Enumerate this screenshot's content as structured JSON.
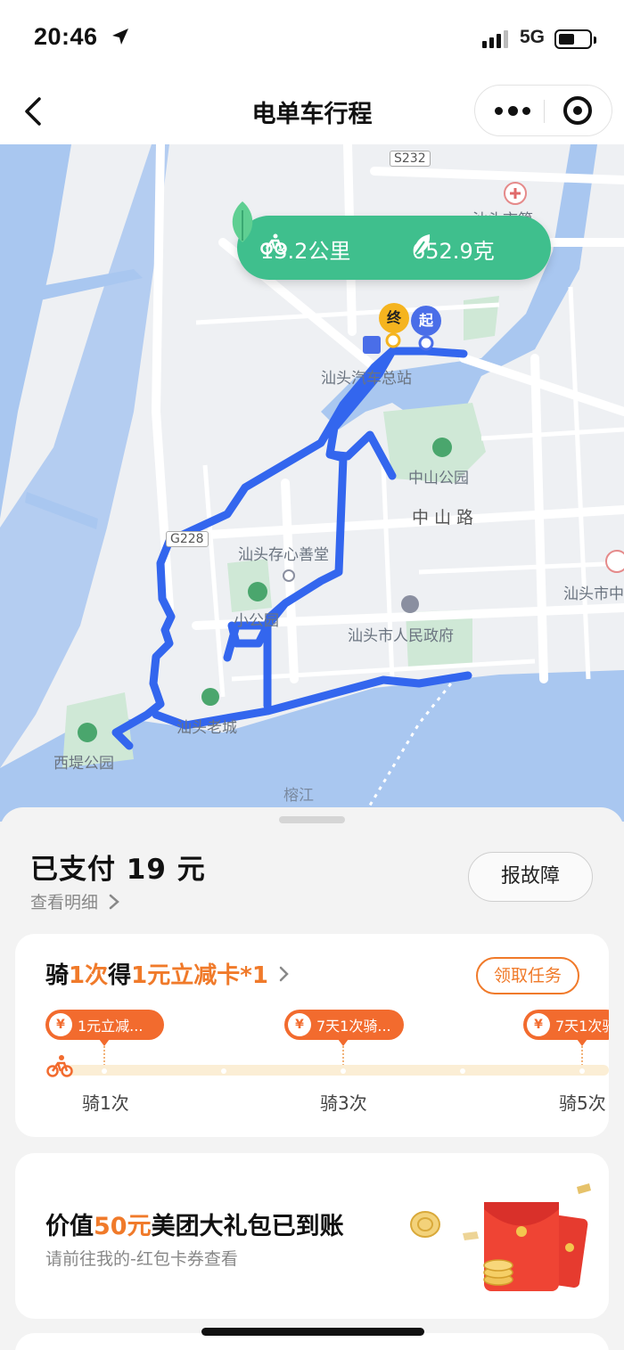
{
  "status_bar": {
    "time": "20:46",
    "network": "5G"
  },
  "nav": {
    "title": "电单车行程",
    "back_icon": "chevron-left-icon",
    "more_icon": "more-dots-icon",
    "close_icon": "target-circle-icon"
  },
  "map": {
    "stats": {
      "distance": "13.2公里",
      "carbon": "652.9克"
    },
    "pins": {
      "end": "终",
      "start": "起"
    },
    "labels": {
      "route_s232": "S232",
      "route_g228": "G228",
      "shantou_station": "汕头汽车总站",
      "zhongshan_park": "中山公园",
      "zhongshan_road": "中山路",
      "cunxin": "汕头存心善堂",
      "xiaogongyuan": "小公园",
      "gov": "汕头市人民政府",
      "old_city": "汕头老城",
      "xidi_park": "西堤公园",
      "rongjiang": "榕江",
      "shantou_city": "汕头市中",
      "hospital": "汕头市第"
    },
    "colors": {
      "route": "#3366ee",
      "water": "#a9c7f0",
      "park": "#cfe8d6",
      "pill": "#3fbf8d"
    }
  },
  "sheet": {
    "paid": "已支付 19 元",
    "detail_link": "查看明细",
    "report_button": "报故障",
    "task": {
      "title_prefix": "骑",
      "title_count": "1次",
      "title_mid": "得",
      "title_reward": "1元立减卡*1",
      "claim_button": "领取任务",
      "currency_symbol": "¥",
      "rewards": [
        {
          "label": "1元立减...",
          "step": "骑1次"
        },
        {
          "label": "7天1次骑...",
          "step": "骑3次"
        },
        {
          "label": "7天1次骑",
          "step": "骑5次"
        }
      ]
    },
    "gift": {
      "title_prefix": "价值",
      "title_amount": "50元",
      "title_suffix": "美团大礼包已到账",
      "subtitle": "请前往我的-红包卡券查看"
    }
  }
}
